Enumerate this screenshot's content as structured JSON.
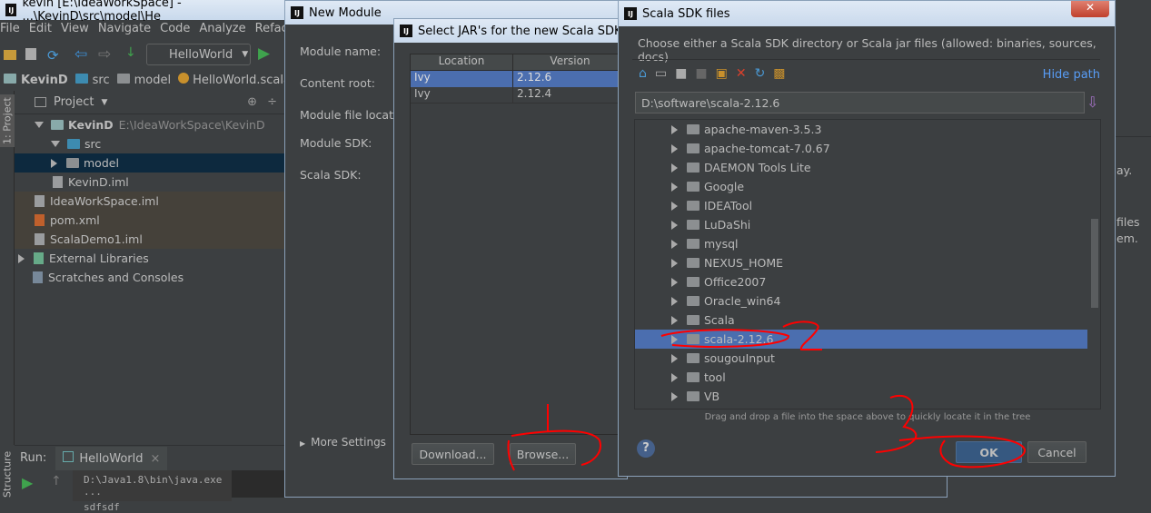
{
  "ide": {
    "title": "kevin [E:\\IdeaWorkSpace] - ...\\KevinD\\src\\model\\He",
    "menu": [
      "File",
      "Edit",
      "View",
      "Navigate",
      "Code",
      "Analyze",
      "Refacto"
    ],
    "run_config": "HelloWorld",
    "breadcrumb": [
      "KevinD",
      "src",
      "model",
      "HelloWorld.scala"
    ],
    "project_label": "Project",
    "side_tab": "1: Project",
    "structure_tab": "Structure",
    "tree": [
      {
        "label": "KevinD",
        "extra": "E:\\IdeaWorkSpace\\KevinD"
      },
      {
        "label": "src"
      },
      {
        "label": "model"
      },
      {
        "label": "KevinD.iml"
      },
      {
        "label": "IdeaWorkSpace.iml"
      },
      {
        "label": "pom.xml"
      },
      {
        "label": "ScalaDemo1.iml"
      },
      {
        "label": "External Libraries"
      },
      {
        "label": "Scratches and Consoles"
      }
    ],
    "run_label": "Run:",
    "run_tab": "HelloWorld",
    "console": [
      "D:\\Java1.8\\bin\\java.exe ...",
      "sdfsdf"
    ],
    "right_fragments": [
      "ay.",
      "files",
      "em."
    ]
  },
  "new_module": {
    "title": "New Module",
    "labels": [
      "Module name:",
      "Content root:",
      "Module file locatio",
      "Module SDK:",
      "Scala SDK:"
    ],
    "more_settings": "More Settings"
  },
  "jars": {
    "title": "Select JAR's for the new Scala SDK",
    "columns": [
      "Location",
      "Version"
    ],
    "rows": [
      {
        "location": "Ivy",
        "version": "2.12.6",
        "selected": true
      },
      {
        "location": "Ivy",
        "version": "2.12.4",
        "selected": false
      }
    ],
    "download": "Download...",
    "browse": "Browse..."
  },
  "sdk": {
    "title": "Scala SDK files",
    "description": "Choose either a Scala SDK directory or Scala jar files (allowed: binaries, sources, docs)",
    "hide_path": "Hide path",
    "path": "D:\\software\\scala-2.12.6",
    "folders": [
      "apache-maven-3.5.3",
      "apache-tomcat-7.0.67",
      "DAEMON Tools Lite",
      "Google",
      "IDEATool",
      "LuDaShi",
      "mysql",
      "NEXUS_HOME",
      "Office2007",
      "Oracle_win64",
      "Scala",
      "scala-2.12.6",
      "sougouInput",
      "tool",
      "VB"
    ],
    "selected": "scala-2.12.6",
    "hint": "Drag and drop a file into the space above to quickly locate it in the tree",
    "ok": "OK",
    "cancel": "Cancel",
    "help": "?"
  },
  "annotations": [
    "1",
    "2",
    "3"
  ],
  "colors": {
    "selection": "#4b6eaf",
    "annotation": "#ff0000",
    "link": "#589df6"
  }
}
